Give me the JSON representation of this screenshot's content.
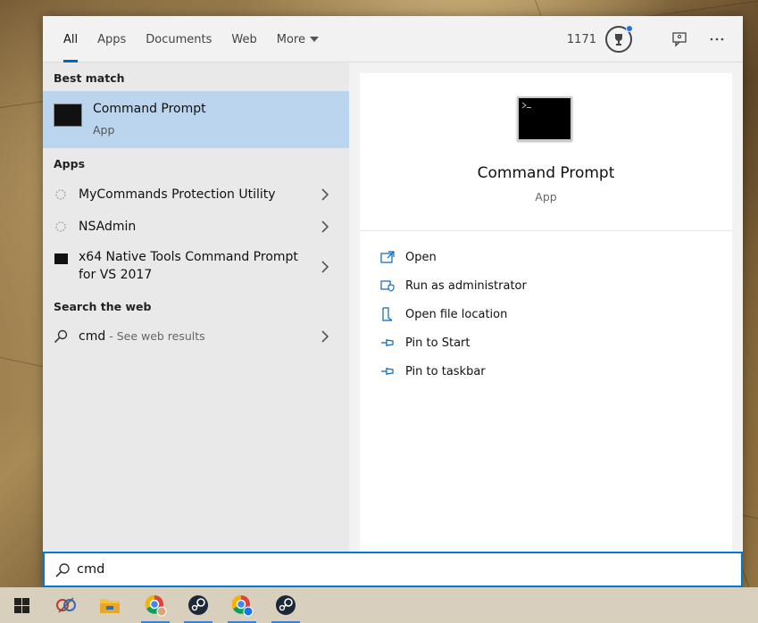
{
  "tabs": [
    {
      "label": "All"
    },
    {
      "label": "Apps"
    },
    {
      "label": "Documents"
    },
    {
      "label": "Web"
    },
    {
      "label": "More"
    }
  ],
  "header": {
    "score": "1171"
  },
  "best_match": {
    "heading": "Best match",
    "title": "Command Prompt",
    "subtitle": "App"
  },
  "apps": {
    "heading": "Apps",
    "items": [
      {
        "label": "MyCommands Protection Utility"
      },
      {
        "label": "NSAdmin"
      },
      {
        "label": "x64 Native Tools Command Prompt",
        "label2": "for VS 2017"
      }
    ]
  },
  "web": {
    "heading": "Search the web",
    "query": "cmd",
    "suffix": " - See web results"
  },
  "preview": {
    "title": "Command Prompt",
    "subtitle": "App",
    "actions": [
      {
        "label": "Open",
        "icon": "open-icon"
      },
      {
        "label": "Run as administrator",
        "icon": "shield-icon"
      },
      {
        "label": "Open file location",
        "icon": "file-location-icon"
      },
      {
        "label": "Pin to Start",
        "icon": "pin-icon"
      },
      {
        "label": "Pin to taskbar",
        "icon": "pin-icon"
      }
    ]
  },
  "search": {
    "value": "cmd"
  },
  "colors": {
    "accent": "#0078d7",
    "selection": "#bcd5ef"
  }
}
